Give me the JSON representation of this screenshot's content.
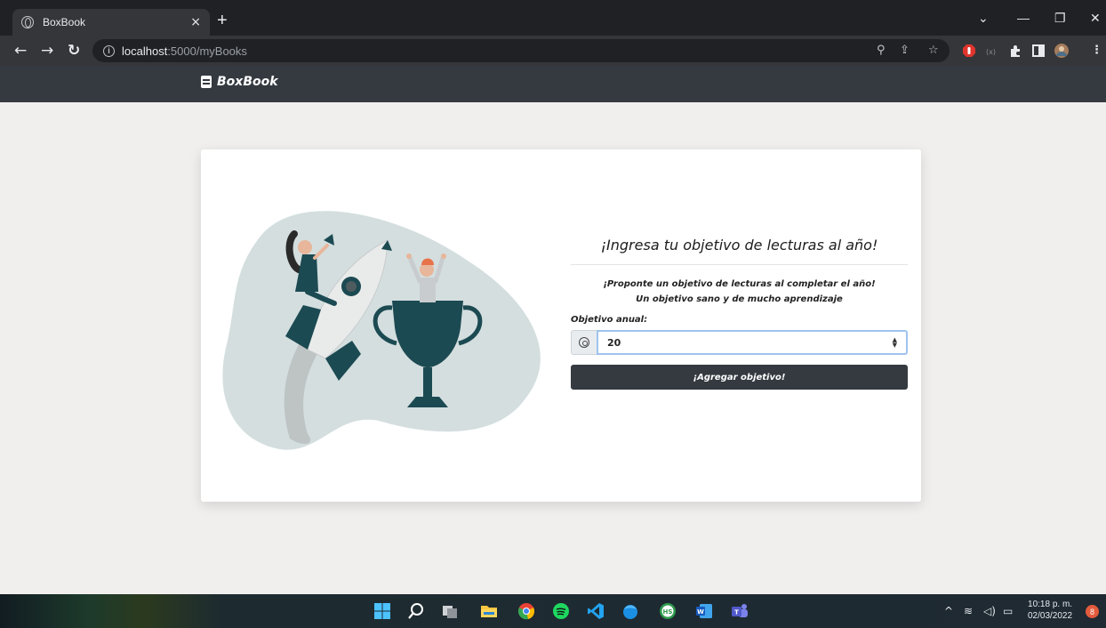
{
  "browser": {
    "tab_title": "BoxBook",
    "tab_close": "×",
    "new_tab": "+",
    "url_host": "localhost",
    "url_path": ":5000/myBooks",
    "window_controls": {
      "dropdown": "⌄",
      "minimize": "—",
      "restore": "❐",
      "close": "✕"
    }
  },
  "navbar": {
    "brand": "BoxBook"
  },
  "card": {
    "heading": "¡Ingresa tu objetivo de lecturas al año!",
    "subtext_line1": "¡Proponte un objetivo de lecturas al completar el año!",
    "subtext_line2": "Un objetivo sano y de mucho aprendizaje",
    "field_label": "Objetivo anual:",
    "field_value": "20",
    "submit_label": "¡Agregar objetivo!"
  },
  "taskbar": {
    "time": "10:18 p. m.",
    "date": "02/03/2022",
    "notifications": "8"
  },
  "colors": {
    "navbar": "#343a40",
    "page_bg": "#f1efee",
    "accent_teal": "#1c4a52",
    "blob": "#d4dedf"
  }
}
